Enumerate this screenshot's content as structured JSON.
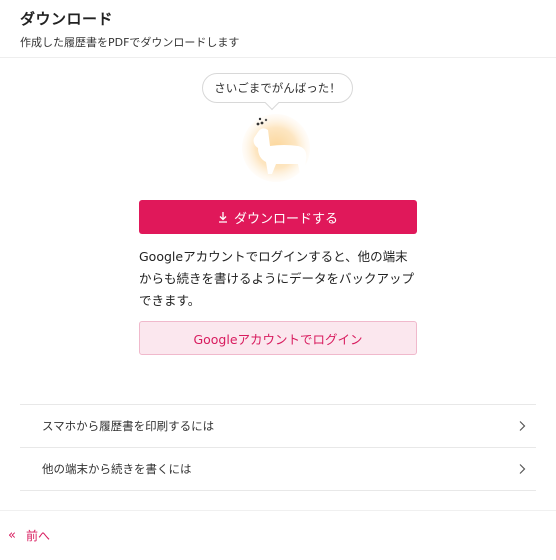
{
  "header": {
    "title": "ダウンロード",
    "subtitle": "作成した履歴書をPDFでダウンロードします"
  },
  "bubble": {
    "text": "さいごまでがんばった！"
  },
  "download_button": {
    "label": "ダウンロードする",
    "icon": "download-icon"
  },
  "info": {
    "text": "Googleアカウントでログインすると、他の端末からも続きを書けるようにデータをバックアップできます。"
  },
  "login_button": {
    "label": "Googleアカウントでログイン"
  },
  "links": [
    {
      "label": "スマホから履歴書を印刷するには",
      "icon": "chevron-right-icon"
    },
    {
      "label": "他の端末から続きを書くには",
      "icon": "chevron-right-icon"
    }
  ],
  "back": {
    "label": "前へ",
    "icon": "double-chevron-left-icon"
  },
  "colors": {
    "accent": "#e0185a",
    "accent_light": "#fbe7ee",
    "accent_text": "#d81b5e"
  }
}
